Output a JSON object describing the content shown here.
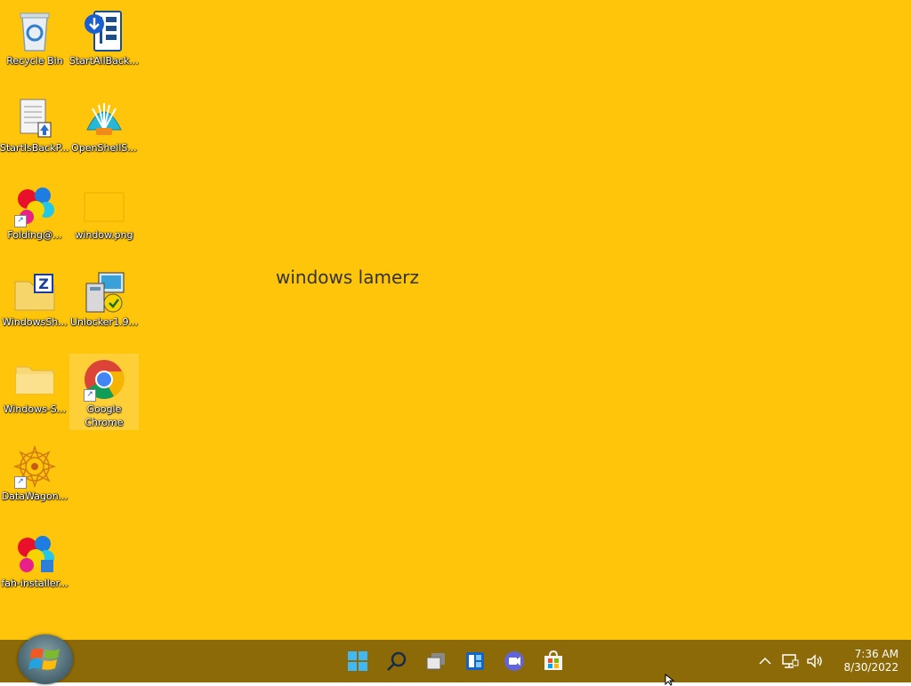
{
  "desktop": {
    "wallpaper_text": "windows lamerz",
    "icons": [
      {
        "label": "Recycle Bin",
        "icon": "recycle-bin-icon"
      },
      {
        "label": "StartAllBack...",
        "icon": "startallback-icon"
      },
      {
        "label": "StartIsBackP...",
        "icon": "startisback-icon"
      },
      {
        "label": "OpenShellS...",
        "icon": "openshell-icon"
      },
      {
        "label": "Folding@...",
        "icon": "folding-at-home-icon"
      },
      {
        "label": "window.png",
        "icon": "image-file-icon"
      },
      {
        "label": "WindowsSh...",
        "icon": "winrar-archive-icon"
      },
      {
        "label": "Unlocker1.9...",
        "icon": "installer-icon"
      },
      {
        "label": "Windows-S...",
        "icon": "folder-icon"
      },
      {
        "label": "Google Chrome",
        "icon": "chrome-icon"
      },
      {
        "label": "DataWagon...",
        "icon": "datawagon-icon"
      },
      {
        "label": "fah-installer...",
        "icon": "fah-installer-icon"
      }
    ]
  },
  "taskbar": {
    "start_icon": "windows-7-start-orb-icon",
    "pinned": [
      "windows-start-icon",
      "search-icon",
      "task-view-icon",
      "widgets-icon",
      "teams-chat-icon",
      "microsoft-store-icon"
    ],
    "tray": [
      "chevron-up-icon",
      "network-icon",
      "volume-icon"
    ],
    "time": "7:36 AM",
    "date": "8/30/2022"
  },
  "colors": {
    "desktop_bg": "#fec50b",
    "taskbar_bg": "#8c6a08"
  }
}
